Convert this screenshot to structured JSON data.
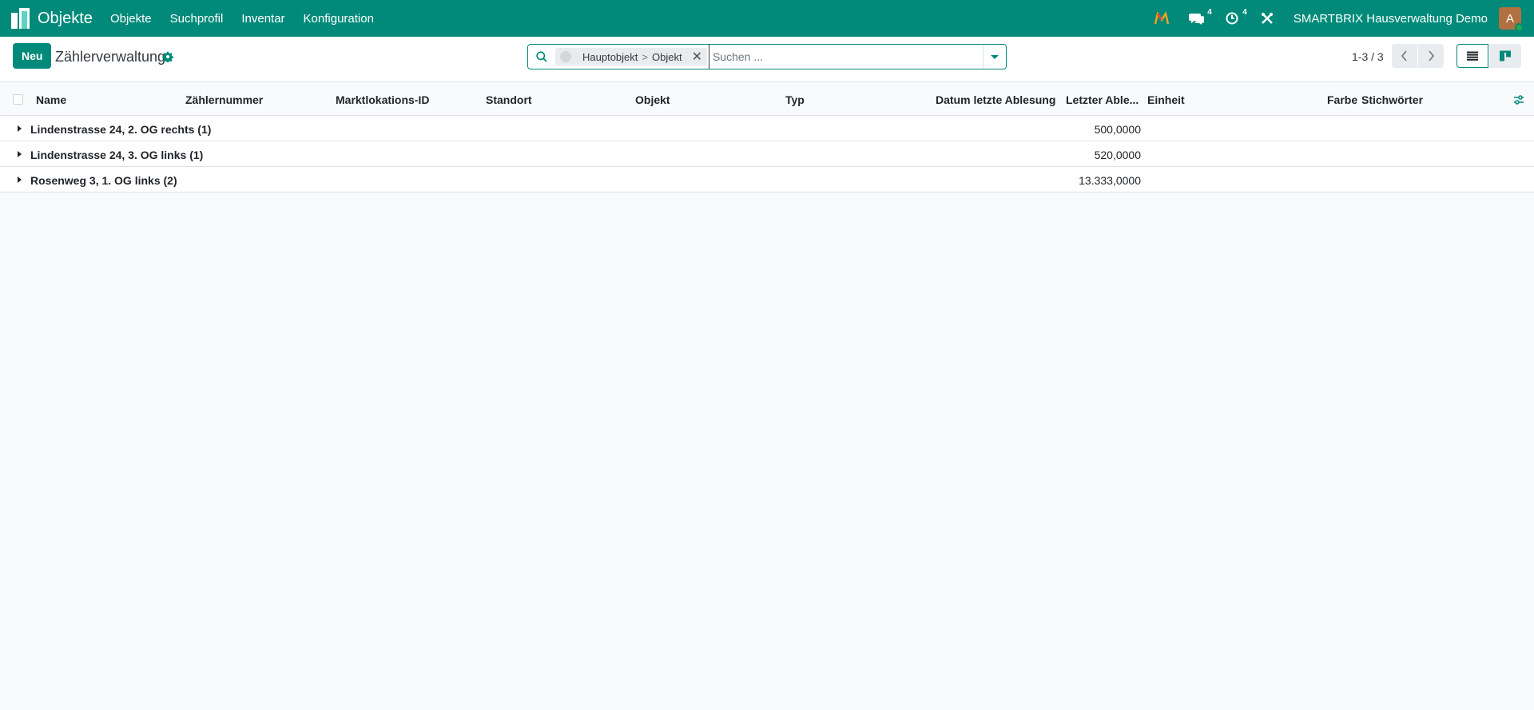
{
  "navbar": {
    "app_title": "Objekte",
    "menu": [
      "Objekte",
      "Suchprofil",
      "Inventar",
      "Konfiguration"
    ],
    "messages_count": "4",
    "activities_count": "4",
    "company": "SMARTBRIX Hausverwaltung Demo",
    "avatar_letter": "A",
    "colors": {
      "primary": "#018a7a",
      "avatar": "#b0703f",
      "status": "#28a745"
    }
  },
  "control": {
    "new_label": "Neu",
    "title": "Zählerverwaltung",
    "facet": {
      "part1": "Hauptobjekt",
      "separator": ">",
      "part2": "Objekt"
    },
    "search_placeholder": "Suchen ...",
    "pager": "1-3 / 3"
  },
  "table": {
    "columns": [
      "Name",
      "Zählernummer",
      "Marktlokations-ID",
      "Standort",
      "Objekt",
      "Typ",
      "Datum letzte Ablesung",
      "Letzter Able...",
      "Einheit",
      "Farbe",
      "Stichwörter"
    ],
    "groups": [
      {
        "name": "Lindenstrasse 24, 2. OG rechts (1)",
        "value": "500,0000"
      },
      {
        "name": "Lindenstrasse 24, 3. OG links (1)",
        "value": "520,0000"
      },
      {
        "name": "Rosenweg 3, 1. OG links (2)",
        "value": "13.333,0000"
      }
    ]
  }
}
